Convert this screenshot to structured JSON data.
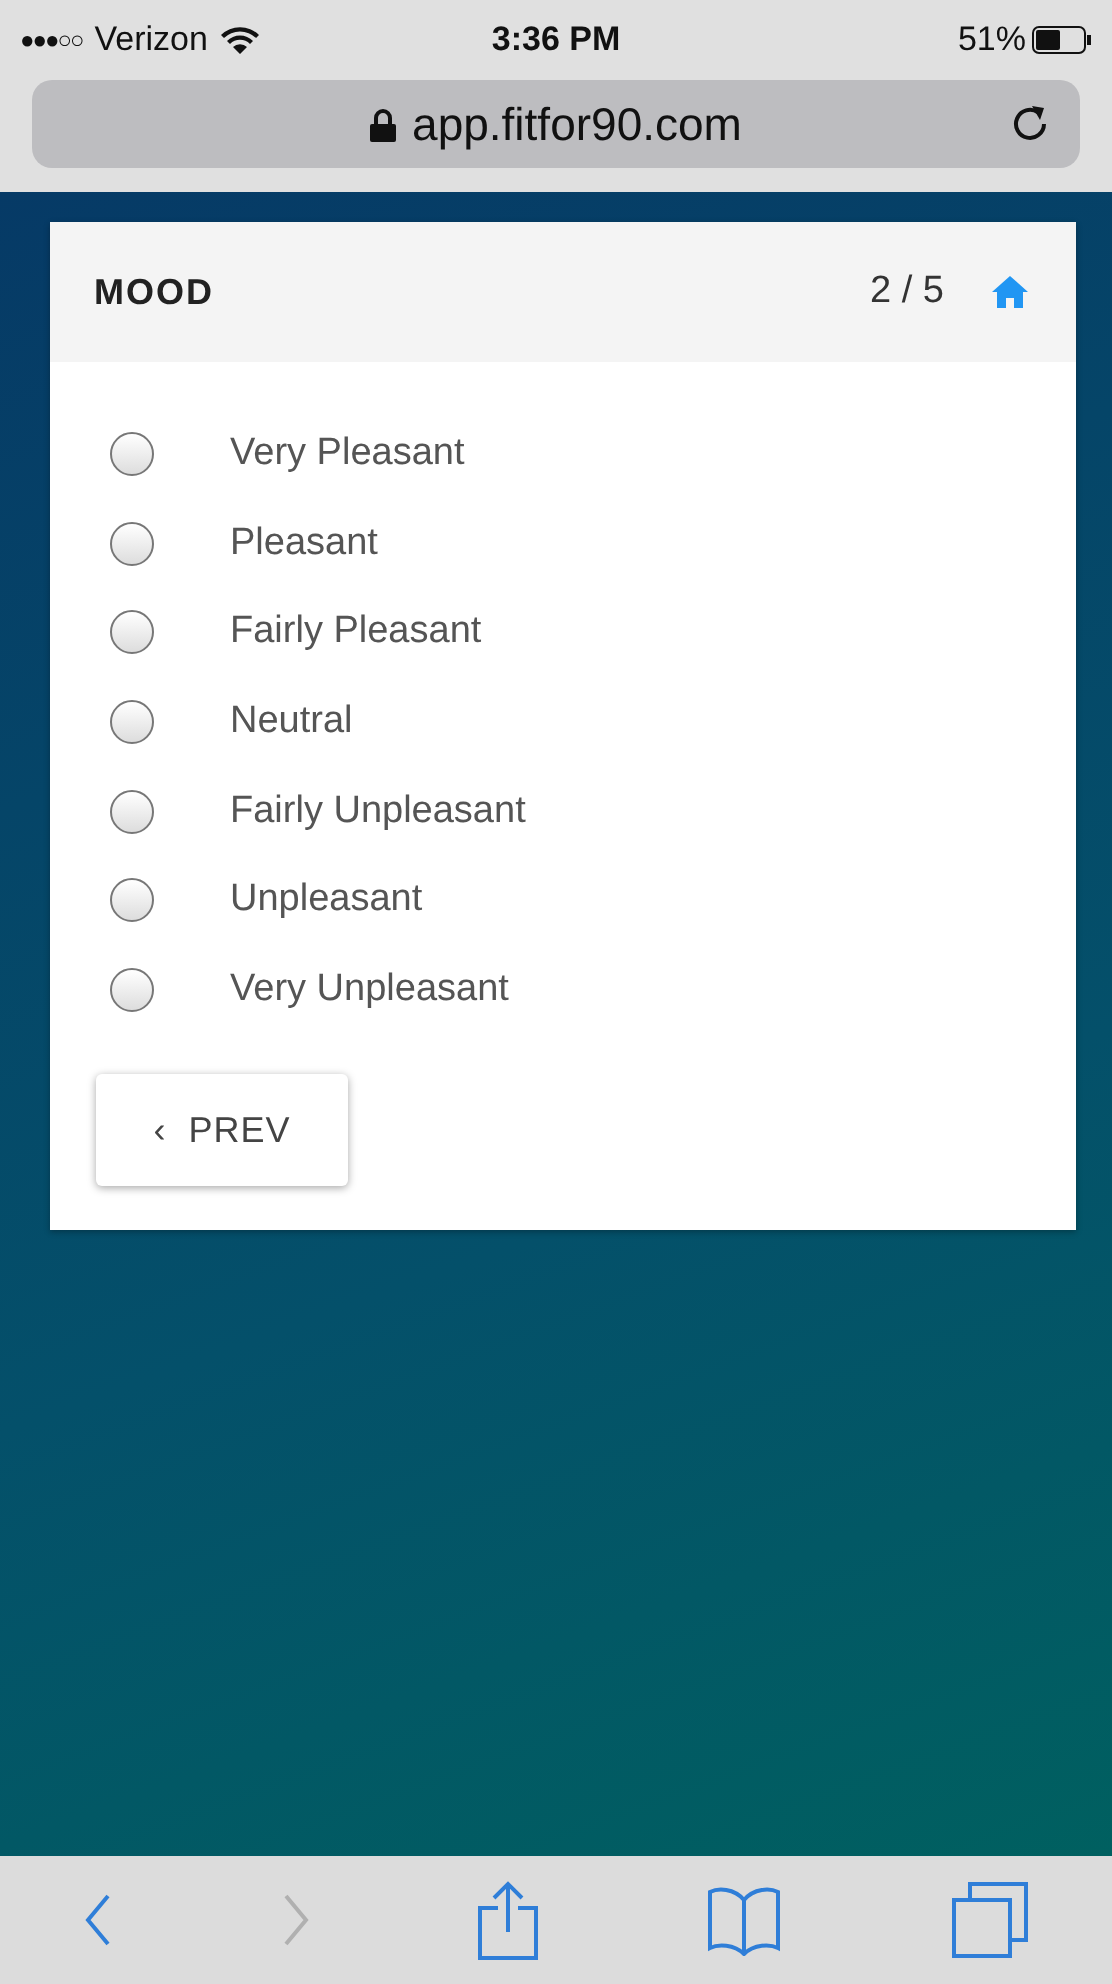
{
  "status_bar": {
    "signal": "●●●○○",
    "carrier": "Verizon",
    "time": "3:36 PM",
    "battery": "51%"
  },
  "address_bar": {
    "url": "app.fitfor90.com",
    "secure": true
  },
  "card": {
    "title": "MOOD",
    "progress": "2 / 5",
    "options": [
      {
        "label": "Very Pleasant",
        "selected": false
      },
      {
        "label": "Pleasant",
        "selected": false
      },
      {
        "label": "Fairly Pleasant",
        "selected": false
      },
      {
        "label": "Neutral",
        "selected": false
      },
      {
        "label": "Fairly Unpleasant",
        "selected": false
      },
      {
        "label": "Unpleasant",
        "selected": false
      },
      {
        "label": "Very Unpleasant",
        "selected": false
      }
    ],
    "prev_button": {
      "chevron": "‹",
      "label": "PREV"
    }
  },
  "toolbar": {
    "back_disabled": false,
    "forward_disabled": true
  }
}
